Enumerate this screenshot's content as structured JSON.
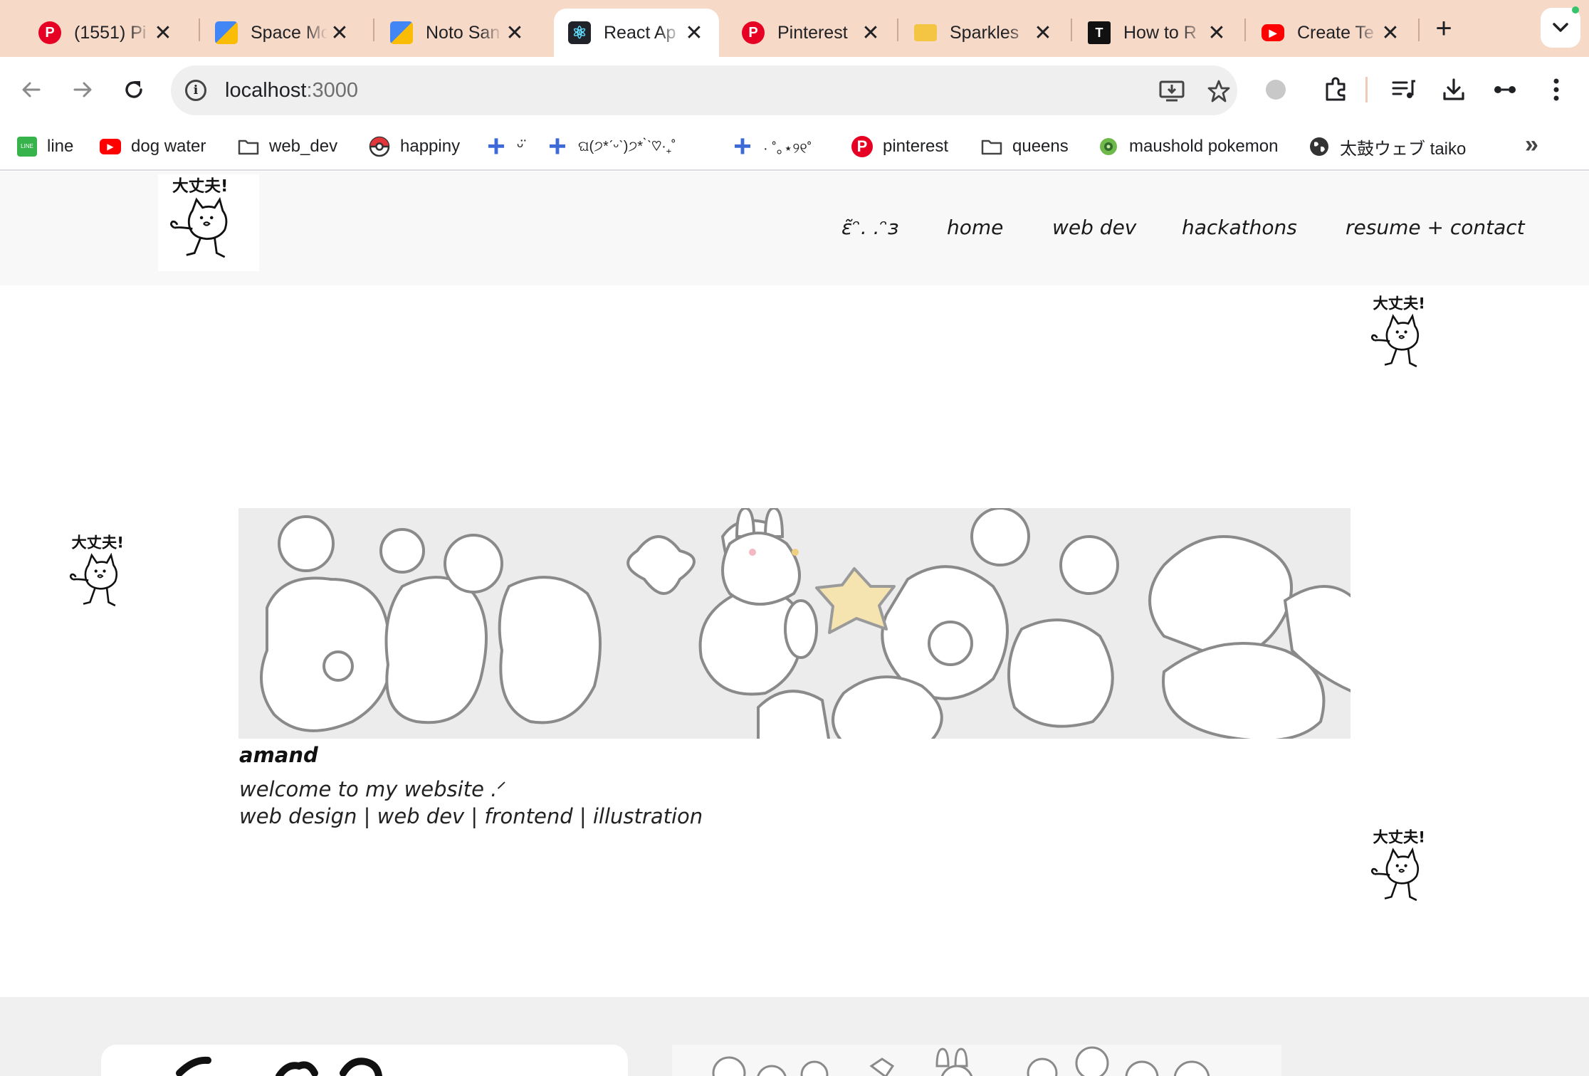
{
  "browser": {
    "tabs": [
      {
        "title": "(1551) Pi",
        "icon": "pinterest-icon",
        "color": "#e60023"
      },
      {
        "title": "Space Mo",
        "icon": "google-fonts-icon",
        "color": "#4285f4"
      },
      {
        "title": "Noto San",
        "icon": "google-fonts-icon",
        "color": "#4285f4"
      },
      {
        "title": "React Ap",
        "icon": "react-icon",
        "color": "#20232a"
      },
      {
        "title": "Pinterest",
        "icon": "pinterest-icon",
        "color": "#e60023"
      },
      {
        "title": "Sparkles",
        "icon": "folder-icon",
        "color": "#f4c542"
      },
      {
        "title": "How to R",
        "icon": "site-icon",
        "color": "#111111"
      },
      {
        "title": "Create Te",
        "icon": "youtube-icon",
        "color": "#ff0000"
      }
    ],
    "active_tab_index": 3,
    "url_host": "localhost",
    "url_port": ":3000",
    "bookmarks": [
      {
        "label": "line",
        "icon": "line-store-icon"
      },
      {
        "label": "dog water",
        "icon": "youtube-icon"
      },
      {
        "label": "web_dev",
        "icon": "folder-icon"
      },
      {
        "label": "happiny",
        "icon": "pokeball-icon"
      },
      {
        "label": "ᵕ̈",
        "icon": "plus-icon"
      },
      {
        "label": "ଘ(੭*ˊᵕˋ)੭* ̀ˋ♡·₊˚",
        "icon": "plus-icon"
      },
      {
        "label": "· ˚｡⋆୨୧˚",
        "icon": "plus-icon"
      },
      {
        "label": "pinterest",
        "icon": "pinterest-icon"
      },
      {
        "label": "queens",
        "icon": "folder-icon"
      },
      {
        "label": "maushold pokemon",
        "icon": "pokemon-icon"
      },
      {
        "label": "太鼓ウェブ taiko",
        "icon": "globe-icon"
      }
    ]
  },
  "site": {
    "nav": [
      "ɛ̃ᵔ. .ᵔɜ",
      "home",
      "web dev",
      "hackathons",
      "resume + contact"
    ],
    "sticker_text": "大丈夫!",
    "name": "amand",
    "tagline_1": "welcome to my website .ᐟ",
    "tagline_2": "web design | web dev | frontend | illustration"
  },
  "colors": {
    "tab_strip": "#f7d9c8",
    "banner_star": "#f5e4b0",
    "header_bg": "#f8f8f8"
  }
}
